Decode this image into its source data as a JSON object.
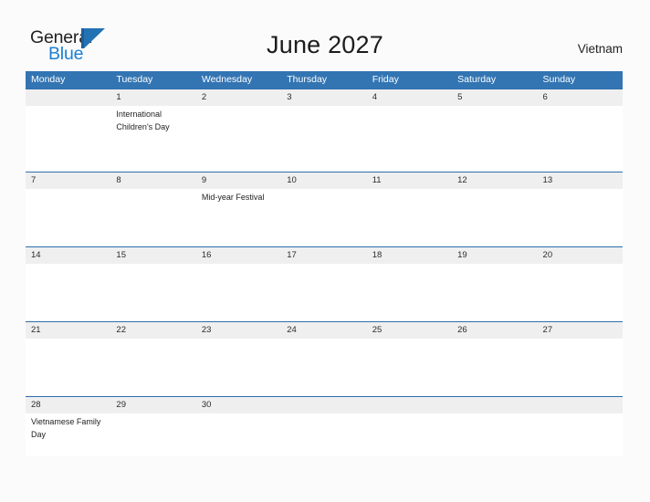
{
  "brand": {
    "name_part1": "General",
    "name_part2": "Blue",
    "mark_icon": "triangle-flag-icon",
    "color_dark": "#222222",
    "color_blue": "#1a7fd4",
    "mark_color": "#2272b4"
  },
  "header": {
    "title": "June 2027",
    "country": "Vietnam"
  },
  "theme": {
    "header_bar": "#3375b3",
    "row_divider": "#2f6fad",
    "date_band": "#efefef",
    "page_bg": "#fbfbfb",
    "cell_bg": "#ffffff"
  },
  "calendar": {
    "weekdays": [
      "Monday",
      "Tuesday",
      "Wednesday",
      "Thursday",
      "Friday",
      "Saturday",
      "Sunday"
    ],
    "weeks": [
      {
        "dates": [
          "",
          "1",
          "2",
          "3",
          "4",
          "5",
          "6"
        ],
        "events": [
          "",
          "International Children's Day",
          "",
          "",
          "",
          "",
          ""
        ]
      },
      {
        "dates": [
          "7",
          "8",
          "9",
          "10",
          "11",
          "12",
          "13"
        ],
        "events": [
          "",
          "",
          "Mid-year Festival",
          "",
          "",
          "",
          ""
        ]
      },
      {
        "dates": [
          "14",
          "15",
          "16",
          "17",
          "18",
          "19",
          "20"
        ],
        "events": [
          "",
          "",
          "",
          "",
          "",
          "",
          ""
        ]
      },
      {
        "dates": [
          "21",
          "22",
          "23",
          "24",
          "25",
          "26",
          "27"
        ],
        "events": [
          "",
          "",
          "",
          "",
          "",
          "",
          ""
        ]
      },
      {
        "dates": [
          "28",
          "29",
          "30",
          "",
          "",
          "",
          ""
        ],
        "events": [
          "Vietnamese Family Day",
          "",
          "",
          "",
          "",
          "",
          ""
        ]
      }
    ]
  }
}
